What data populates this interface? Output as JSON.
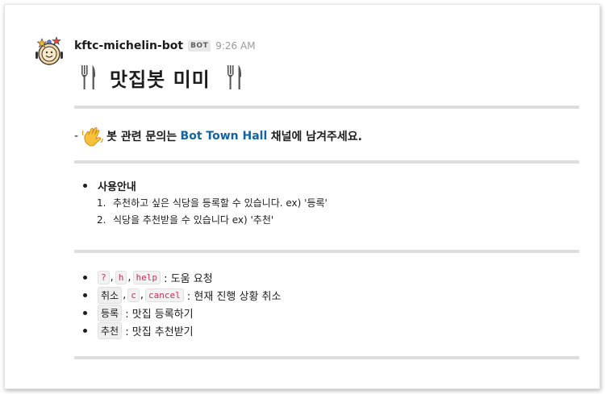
{
  "message": {
    "bot_name": "kftc-michelin-bot",
    "badge": "BOT",
    "time": "9:26 AM",
    "title": "맛집봇 미미",
    "notice": {
      "dash": "-",
      "before_link": "봇 관련 문의는",
      "link": "Bot Town Hall",
      "after_link": "채널에 남겨주세요."
    },
    "usage": {
      "heading": "사용안내",
      "steps": [
        {
          "num": "1.",
          "text": "추천하고 싶은 식당을 등록할 수 있습니다. ex) '등록'"
        },
        {
          "num": "2.",
          "text": "식당을 추천받을 수 있습니다 ex) '추천'"
        }
      ]
    },
    "commands": [
      {
        "keys": [
          "?",
          "h",
          "help"
        ],
        "desc": ": 도움 요청",
        "mono": true
      },
      {
        "keys": [
          "취소",
          "c",
          "cancel"
        ],
        "desc": ": 현재 진행 상황 취소",
        "mono": true
      },
      {
        "keys": [
          "등록"
        ],
        "desc": ": 맛집 등록하기",
        "mono": false
      },
      {
        "keys": [
          "추천"
        ],
        "desc": ": 맛집 추천받기",
        "mono": false
      }
    ]
  },
  "icons": {
    "avatar": "bot-avatar-icon",
    "title_left": "fork-knife-icon",
    "title_right": "fork-knife-icon",
    "notice": "waving-hand-icon"
  },
  "colors": {
    "link": "#1264a3",
    "divider": "#dddddd",
    "code_text": "#c4325a"
  }
}
